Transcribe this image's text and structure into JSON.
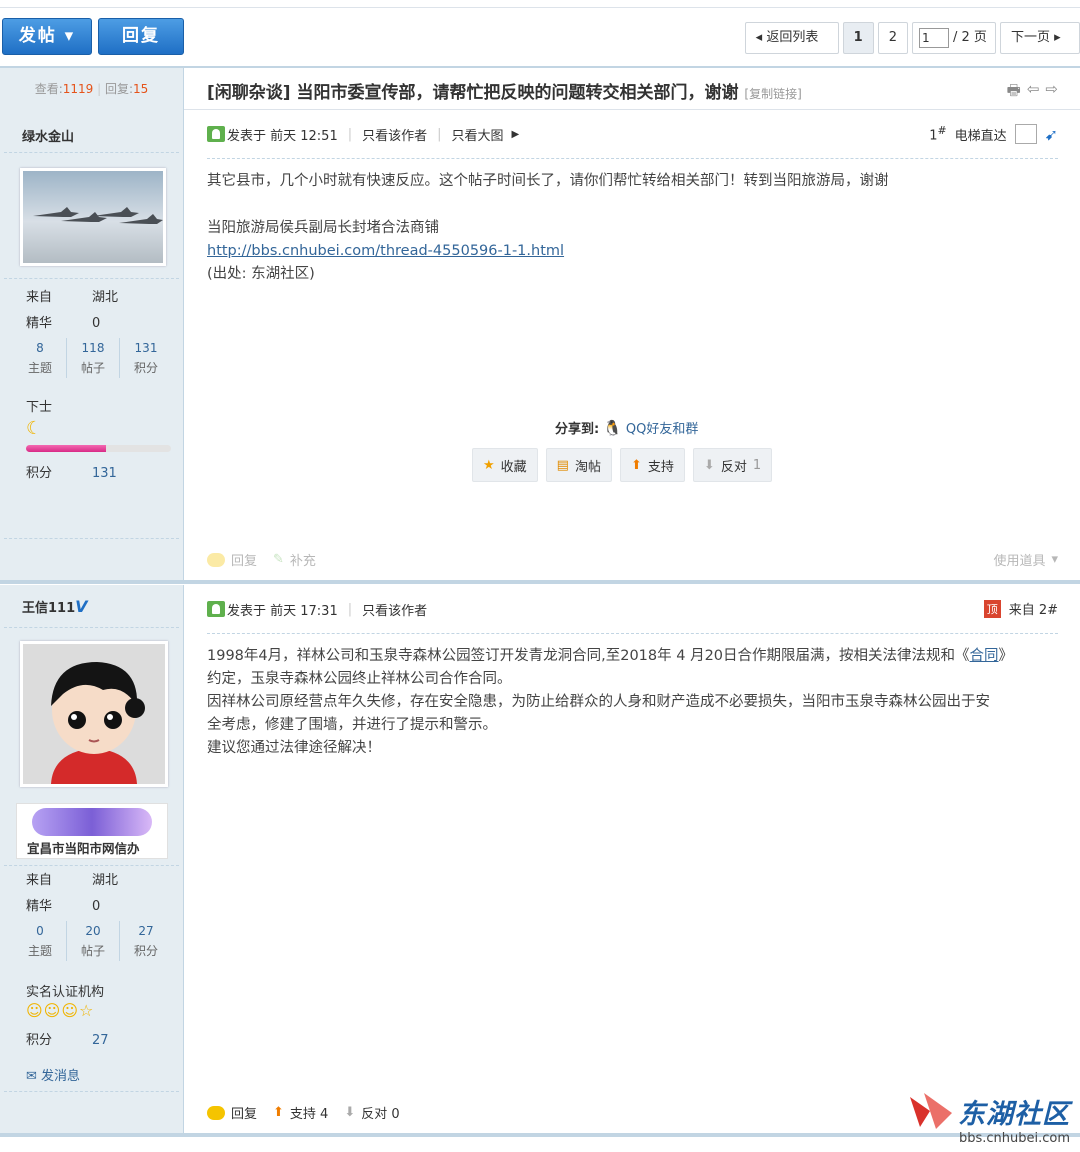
{
  "toolbar": {
    "post_label": "发帖 ▾",
    "reply_label": "回复",
    "back_label": "返回列表",
    "pages": [
      "1",
      "2"
    ],
    "page_input_value": "1",
    "page_total": "/ 2 页",
    "next_label": "下一页"
  },
  "thread": {
    "views_label": "查看:",
    "views": "1119",
    "replies_label": "回复:",
    "replies": "15",
    "title": "[闲聊杂谈] 当阳市委宣传部，请帮忙把反映的问题转交相关部门，谢谢",
    "copy_link": "[复制链接]"
  },
  "posts": [
    {
      "username": "绿水金山",
      "from_label": "来自",
      "from_value": "湖北",
      "digest_label": "精华",
      "digest_value": "0",
      "stats": [
        {
          "value": "8",
          "label": "主题"
        },
        {
          "value": "118",
          "label": "帖子"
        },
        {
          "value": "131",
          "label": "积分"
        }
      ],
      "rank": "下士",
      "points_label": "积分",
      "points_value": "131",
      "level_progress": 0.55,
      "posted": "发表于 前天 12:51",
      "only_author": "只看该作者",
      "big_pic": "只看大图",
      "floor": "1",
      "floor_sup": "#",
      "elevator": "电梯直达",
      "lines": [
        "其它县市，几个小时就有快速反应。这个帖子时间长了，请你们帮忙转给相关部门！转到当阳旅游局，谢谢",
        "当阳旅游局侯兵副局长封堵合法商铺",
        "http://bbs.cnhubei.com/thread-4550596-1-1.html",
        "(出处: 东湖社区)"
      ],
      "share_label": "分享到:",
      "share_target": "QQ好友和群",
      "actions": [
        "收藏",
        "淘帖",
        "支持",
        "反对"
      ],
      "oppose_count": "1",
      "foot": [
        "回复",
        "补充",
        "使用道具"
      ]
    },
    {
      "username": "王信111",
      "verified_mark": "V",
      "org": "宜昌市当阳市网信办",
      "from_label": "来自",
      "from_value": "湖北",
      "digest_label": "精华",
      "digest_value": "0",
      "stats": [
        {
          "value": "0",
          "label": "主题"
        },
        {
          "value": "20",
          "label": "帖子"
        },
        {
          "value": "27",
          "label": "积分"
        }
      ],
      "rank": "实名认证机构",
      "points_label": "积分",
      "points_value": "27",
      "message": "发消息",
      "posted": "发表于 前天 17:31",
      "only_author": "只看该作者",
      "from_floor": "来自 2#",
      "lines": [
        "1998年4月，祥林公司和玉泉寺森林公园签订开发青龙洞合同,至2018年 4 月20日合作期限届满，按相关法律法规和《",
        "合同",
        "》",
        "约定，玉泉寺森林公园终止祥林公司合作合同。",
        "因祥林公司原经营点年久失修，存在安全隐患，为防止给群众的人身和财产造成不必要损失，当阳市玉泉寺森林公园出于安",
        "全考虑，修建了围墙，并进行了提示和警示。",
        "建议您通过法律途径解决！"
      ],
      "foot": [
        "回复",
        "支持 4",
        "反对 0"
      ]
    }
  ],
  "watermark": {
    "name": "东湖社区",
    "url": "bbs.cnhubei.com"
  }
}
